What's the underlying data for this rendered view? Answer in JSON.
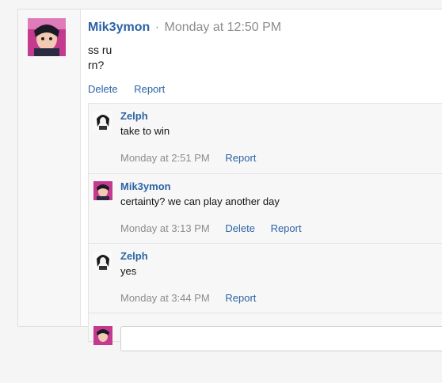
{
  "post": {
    "author": "Mik3ymon",
    "separator": "·",
    "time": "Monday at 12:50 PM",
    "body_lines": [
      "ss ru",
      "rn?"
    ],
    "actions": {
      "delete": "Delete",
      "report": "Report"
    }
  },
  "comments": [
    {
      "author": "Zelph",
      "text": "take to win",
      "time": "Monday at 2:51 PM",
      "report": "Report"
    },
    {
      "author": "Mik3ymon",
      "text": "certainty? we can play another day",
      "time": "Monday at 3:13 PM",
      "delete": "Delete",
      "report": "Report"
    },
    {
      "author": "Zelph",
      "text": "yes",
      "time": "Monday at 3:44 PM",
      "report": "Report"
    }
  ],
  "colors": {
    "link": "#2b63a5",
    "muted": "#8c8c8c",
    "panel": "#f7f7f7"
  }
}
